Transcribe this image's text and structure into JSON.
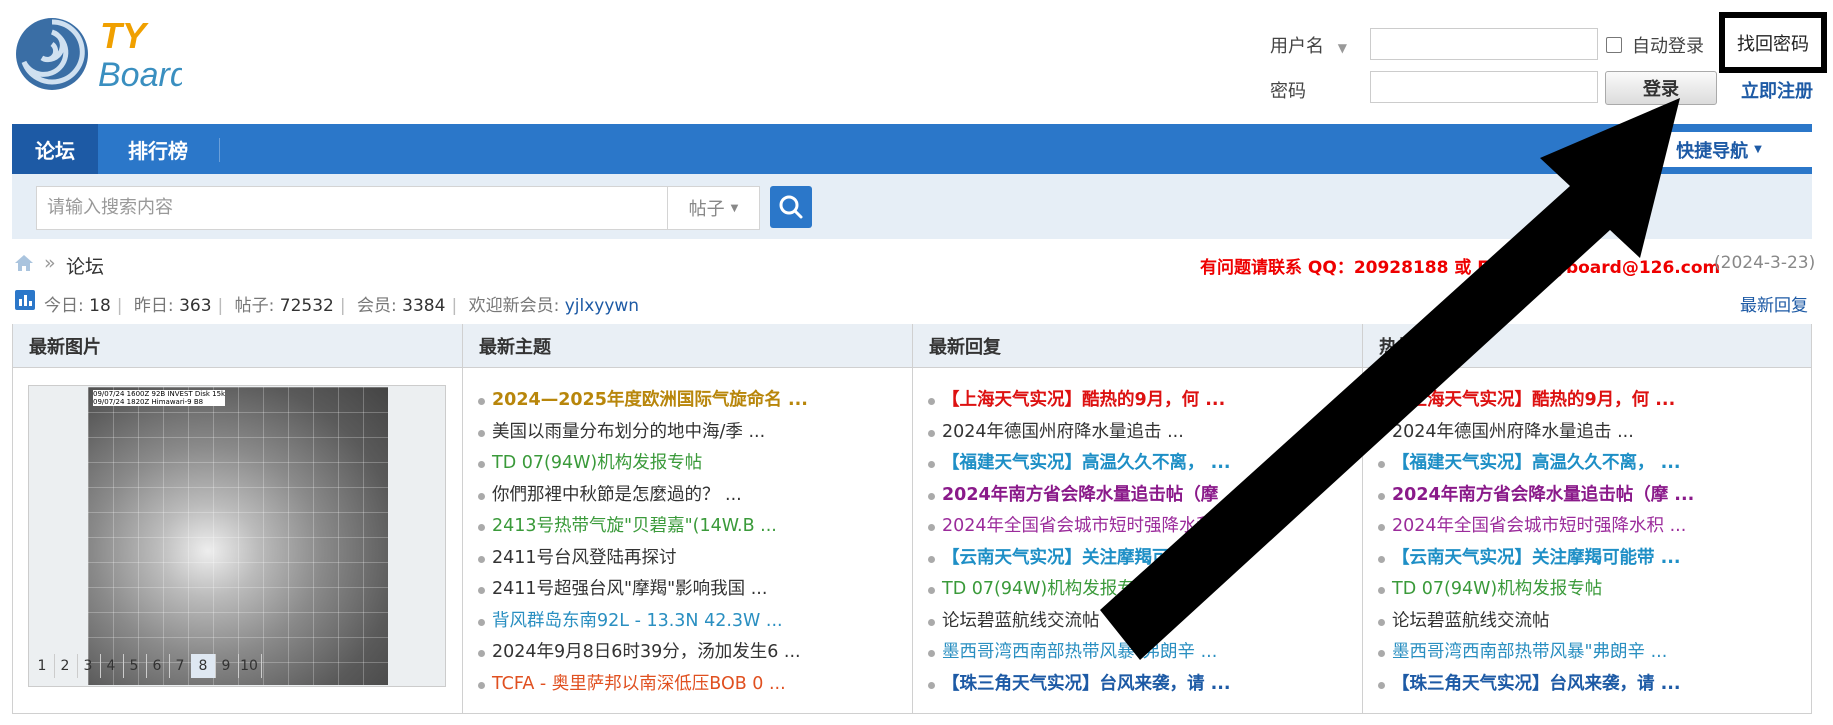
{
  "header": {
    "logo_text_top": "TY",
    "logo_text_bottom": "Board",
    "username_label": "用户名",
    "password_label": "密码",
    "remember_label": "自动登录",
    "forgot_label": "找回密码",
    "login_label": "登录",
    "register_label": "立即注册"
  },
  "nav": {
    "items": [
      {
        "label": "论坛"
      },
      {
        "label": "排行榜"
      }
    ],
    "quick_nav": "快捷导航"
  },
  "search": {
    "placeholder": "请输入搜索内容",
    "type": "帖子"
  },
  "breadcrumb": {
    "separator": "»",
    "current": "论坛"
  },
  "contact": {
    "text": "有问题请联系 QQ：20928188 或 Email：tyboard@126.com",
    "date": "(2024-3-23)"
  },
  "stats": {
    "today_label": "今日:",
    "today": "18",
    "yesterday_label": "昨日:",
    "yesterday": "363",
    "posts_label": "帖子:",
    "posts": "72532",
    "members_label": "会员:",
    "members": "3384",
    "newmember_label": "欢迎新会员:",
    "newmember": "yjlxyywn",
    "latest_reply_link": "最新回复"
  },
  "columns": {
    "images_title": "最新图片",
    "topics_title": "最新主题",
    "replies_title": "最新回复",
    "fourth_title": "热帖"
  },
  "satellite": {
    "caption1": "09/07/24 1600Z  92B INVEST Disk 15k",
    "caption2": "09/07/24 1820Z  Himawari-9 B8",
    "pages": [
      "1",
      "2",
      "3",
      "4",
      "5",
      "6",
      "7",
      "8",
      "9",
      "10"
    ]
  },
  "topics": [
    {
      "text": "2024—2025年度欧洲国际气旋命名 ...",
      "color": "#b8860b",
      "bold": true
    },
    {
      "text": "美国以雨量分布划分的地中海/季 ...",
      "color": "#333333",
      "bold": false
    },
    {
      "text": "TD 07(94W)机构发报专帖",
      "color": "#3a9a3a",
      "bold": false
    },
    {
      "text": "你們那裡中秋節是怎麼過的？ ...",
      "color": "#333333",
      "bold": false
    },
    {
      "text": "2413号热带气旋\"贝碧嘉\"(14W.B ...",
      "color": "#3a9a3a",
      "bold": false
    },
    {
      "text": "2411号台风登陆再探讨",
      "color": "#333333",
      "bold": false
    },
    {
      "text": "2411号超强台风\"摩羯\"影响我国 ...",
      "color": "#333333",
      "bold": false
    },
    {
      "text": "背风群岛东南92L - 13.3N 42.3W ...",
      "color": "#2a8fc1",
      "bold": false
    },
    {
      "text": "2024年9月8日6时39分，汤加发生6 ...",
      "color": "#333333",
      "bold": false
    },
    {
      "text": "TCFA - 奥里萨邦以南深低压BOB 0 ...",
      "color": "#e05020",
      "bold": false
    }
  ],
  "replies": [
    {
      "text": "【上海天气实况】酷热的9月，何 ...",
      "color": "#dd1111",
      "bold": true
    },
    {
      "text": "2024年德国州府降水量追击 ...",
      "color": "#333333",
      "bold": false
    },
    {
      "text": "【福建天气实况】高温久久不离， ...",
      "color": "#1e8fc6",
      "bold": true
    },
    {
      "text": "2024年南方省会降水量追击帖（摩 ...",
      "color": "#8a1a8a",
      "bold": true
    },
    {
      "text": "2024年全国省会城市短时强降水积 ...",
      "color": "#9b2b9b",
      "bold": false
    },
    {
      "text": "【云南天气实况】关注摩羯可能带 ...",
      "color": "#1e8fc6",
      "bold": true
    },
    {
      "text": "TD 07(94W)机构发报专帖",
      "color": "#3a9a3a",
      "bold": false
    },
    {
      "text": "论坛碧蓝航线交流帖",
      "color": "#333333",
      "bold": false
    },
    {
      "text": "墨西哥湾西南部热带风暴\"弗朗辛 ...",
      "color": "#2a8fc1",
      "bold": false
    },
    {
      "text": "【珠三角天气实况】台风来袭，请 ...",
      "color": "#1d5aa5",
      "bold": true
    }
  ],
  "hot": [
    {
      "text": "【上海天气实况】酷热的9月，何 ...",
      "color": "#dd1111",
      "bold": true
    },
    {
      "text": "2024年德国州府降水量追击 ...",
      "color": "#333333",
      "bold": false
    },
    {
      "text": "【福建天气实况】高温久久不离， ...",
      "color": "#1e8fc6",
      "bold": true
    },
    {
      "text": "2024年南方省会降水量追击帖（摩 ...",
      "color": "#8a1a8a",
      "bold": true
    },
    {
      "text": "2024年全国省会城市短时强降水积 ...",
      "color": "#9b2b9b",
      "bold": false
    },
    {
      "text": "【云南天气实况】关注摩羯可能带 ...",
      "color": "#1e8fc6",
      "bold": true
    },
    {
      "text": "TD 07(94W)机构发报专帖",
      "color": "#3a9a3a",
      "bold": false
    },
    {
      "text": "论坛碧蓝航线交流帖",
      "color": "#333333",
      "bold": false
    },
    {
      "text": "墨西哥湾西南部热带风暴\"弗朗辛 ...",
      "color": "#2a8fc1",
      "bold": false
    },
    {
      "text": "【珠三角天气实况】台风来袭，请 ...",
      "color": "#1d5aa5",
      "bold": true
    }
  ]
}
